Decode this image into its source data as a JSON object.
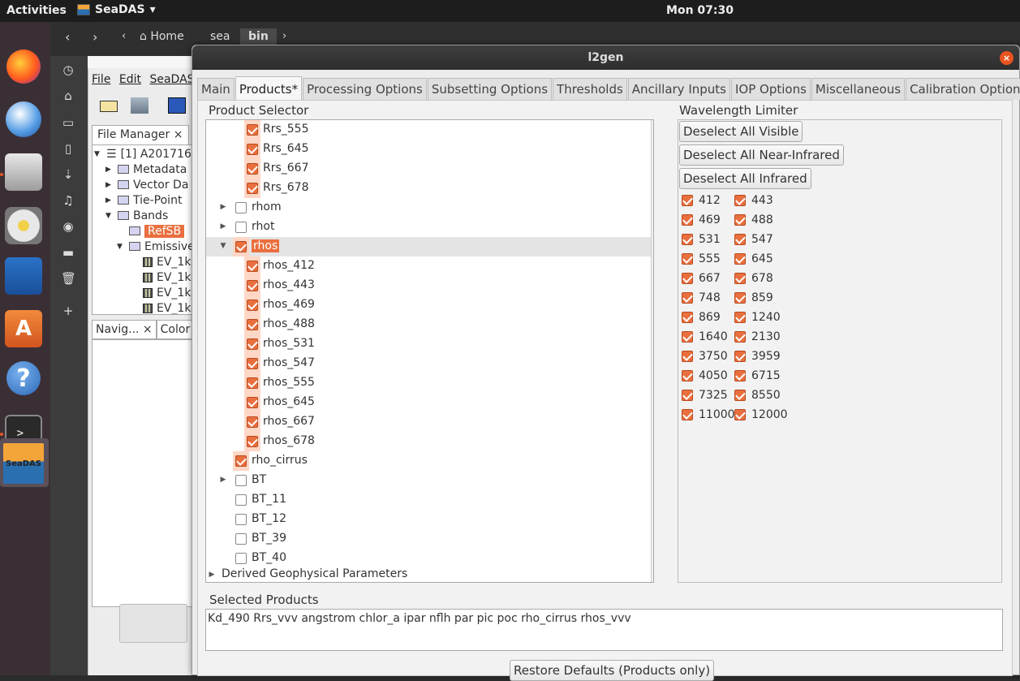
{
  "topbar": {
    "activities": "Activities",
    "app_name": "SeaDAS",
    "app_arrow": "▾",
    "clock": "Mon 07:30"
  },
  "files": {
    "back": "‹",
    "forward": "›",
    "crumb_left": "‹",
    "crumbs": [
      "Home",
      "sea",
      "bin"
    ],
    "crumb_more": "›"
  },
  "seadas_main": {
    "menu": [
      "File",
      "Edit",
      "SeaDAS"
    ],
    "file_manager_tab": "File Manager",
    "tree": {
      "product": "[1] A201716",
      "metadata": "Metadata",
      "vector": "Vector Da",
      "tiepoint": "Tie-Point",
      "bands": "Bands",
      "refsb": "RefSB",
      "emissive": "Emissive",
      "ev": [
        "EV_1k",
        "EV_1k",
        "EV_1k",
        "EV_1k"
      ]
    },
    "nav_tab": "Navig...",
    "color_tab": "Color"
  },
  "dialog": {
    "title": "l2gen",
    "close": "×",
    "tabs": [
      "Main",
      "Products*",
      "Processing Options",
      "Subsetting Options",
      "Thresholds",
      "Ancillary Inputs",
      "IOP Options",
      "Miscellaneous",
      "Calibration Options"
    ],
    "product_selector_label": "Product Selector",
    "products": [
      {
        "label": "Rrs_555",
        "checked": true,
        "level": 2
      },
      {
        "label": "Rrs_645",
        "checked": true,
        "level": 2
      },
      {
        "label": "Rrs_667",
        "checked": true,
        "level": 2
      },
      {
        "label": "Rrs_678",
        "checked": true,
        "level": 2
      },
      {
        "label": "rhom",
        "checked": false,
        "level": 1,
        "expander": "▶"
      },
      {
        "label": "rhot",
        "checked": false,
        "level": 1,
        "expander": "▶"
      },
      {
        "label": "rhos",
        "checked": true,
        "level": 1,
        "expander": "▼",
        "selected": true
      },
      {
        "label": "rhos_412",
        "checked": true,
        "level": 2
      },
      {
        "label": "rhos_443",
        "checked": true,
        "level": 2
      },
      {
        "label": "rhos_469",
        "checked": true,
        "level": 2
      },
      {
        "label": "rhos_488",
        "checked": true,
        "level": 2
      },
      {
        "label": "rhos_531",
        "checked": true,
        "level": 2
      },
      {
        "label": "rhos_547",
        "checked": true,
        "level": 2
      },
      {
        "label": "rhos_555",
        "checked": true,
        "level": 2
      },
      {
        "label": "rhos_645",
        "checked": true,
        "level": 2
      },
      {
        "label": "rhos_667",
        "checked": true,
        "level": 2
      },
      {
        "label": "rhos_678",
        "checked": true,
        "level": 2
      },
      {
        "label": "rho_cirrus",
        "checked": true,
        "level": 1
      },
      {
        "label": "BT",
        "checked": false,
        "level": 1,
        "expander": "▶"
      },
      {
        "label": "BT_11",
        "checked": false,
        "level": 1
      },
      {
        "label": "BT_12",
        "checked": false,
        "level": 1
      },
      {
        "label": "BT_39",
        "checked": false,
        "level": 1
      },
      {
        "label": "BT_40",
        "checked": false,
        "level": 1
      }
    ],
    "derived_label": "Derived Geophysical Parameters",
    "derived_expander": "▶",
    "wavelength_limiter_label": "Wavelength Limiter",
    "buttons": {
      "deselect_visible": "Deselect All Visible",
      "deselect_nir": "Deselect All Near-Infrared",
      "deselect_ir": "Deselect All Infrared"
    },
    "wavelengths": [
      [
        "412",
        "443"
      ],
      [
        "469",
        "488"
      ],
      [
        "531",
        "547"
      ],
      [
        "555",
        "645"
      ],
      [
        "667",
        "678"
      ],
      [
        "748",
        "859"
      ],
      [
        "869",
        "1240"
      ],
      [
        "1640",
        "2130"
      ],
      [
        "3750",
        "3959"
      ],
      [
        "4050",
        "6715"
      ],
      [
        "7325",
        "8550"
      ],
      [
        "11000",
        "12000"
      ]
    ],
    "selected_products_label": "Selected Products",
    "selected_products": "Kd_490 Rrs_vvv angstrom chlor_a ipar nflh par pic poc rho_cirrus rhos_vvv",
    "restore_button": "Restore Defaults (Products only)"
  },
  "colors": {
    "accent": "#e96f3e",
    "ubuntu_orange": "#e95420"
  }
}
